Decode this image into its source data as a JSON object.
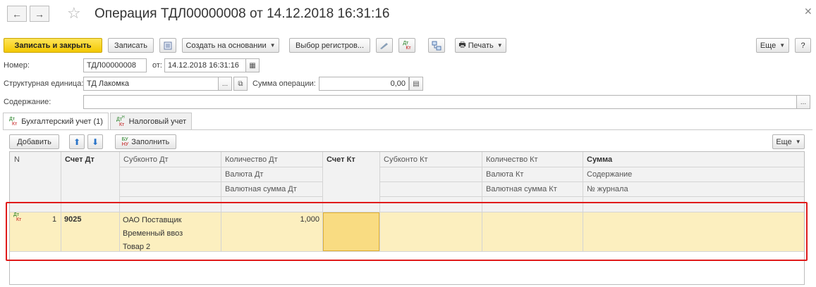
{
  "window": {
    "title": "Операция ТДЛ00000008 от 14.12.2018 16:31:16"
  },
  "toolbar": {
    "save_close": "Записать и закрыть",
    "save": "Записать",
    "create_based": "Создать на основании",
    "registers": "Выбор регистров...",
    "print": "Печать",
    "more": "Еще",
    "help": "?"
  },
  "form": {
    "number_label": "Номер:",
    "number_value": "ТДЛ00000008",
    "date_label": "от:",
    "date_value": "14.12.2018 16:31:16",
    "unit_label": "Структурная единица:",
    "unit_value": "ТД Лакомка",
    "unit_btn": "...",
    "sum_label": "Сумма операции:",
    "sum_value": "0,00",
    "content_label": "Содержание:",
    "content_value": "",
    "content_btn": "..."
  },
  "tabs": [
    {
      "label": "Бухгалтерский учет (1)"
    },
    {
      "label": "Налоговый учет"
    }
  ],
  "table_toolbar": {
    "add": "Добавить",
    "fill": "Заполнить",
    "more": "Еще"
  },
  "table": {
    "headers": {
      "n": "N",
      "acc_dt": "Счет Дт",
      "subconto_dt": "Субконто Дт",
      "qty_dt": "Количество Дт",
      "currency_dt": "Валюта Дт",
      "cur_sum_dt": "Валютная сумма Дт",
      "acc_kt": "Счет Кт",
      "subconto_kt": "Субконто Кт",
      "qty_kt": "Количество Кт",
      "currency_kt": "Валюта Кт",
      "cur_sum_kt": "Валютная сумма Кт",
      "sum": "Сумма",
      "content": "Содержание",
      "journal": "№ журнала"
    },
    "rows": [
      {
        "n": "1",
        "acc_dt": "9025",
        "subconto_dt_1": "ОАО Поставщик",
        "subconto_dt_2": "Временный ввоз",
        "subconto_dt_3": "Товар 2",
        "qty_dt": "1,000",
        "acc_kt": "",
        "sum": ""
      }
    ]
  },
  "colors": {
    "primary_button": "#f3c800",
    "row_highlight": "#fcefbf",
    "selected_cell": "#f9dc82",
    "annotation_box": "#e01b1b"
  }
}
